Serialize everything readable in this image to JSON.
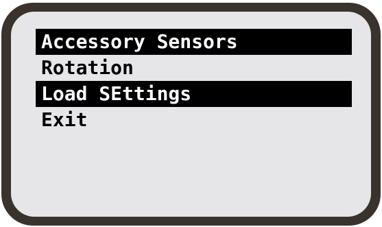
{
  "menu": {
    "items": [
      {
        "label": "Accessory Sensors",
        "highlighted": true
      },
      {
        "label": "Rotation",
        "highlighted": false
      },
      {
        "label": "Load SEttings",
        "highlighted": true
      },
      {
        "label": "Exit",
        "highlighted": false
      }
    ]
  },
  "colors": {
    "bezel": "#3a322d",
    "screen": "#e6e6e8",
    "text": "#000000",
    "highlight_bg": "#000000",
    "highlight_text": "#ffffff"
  }
}
